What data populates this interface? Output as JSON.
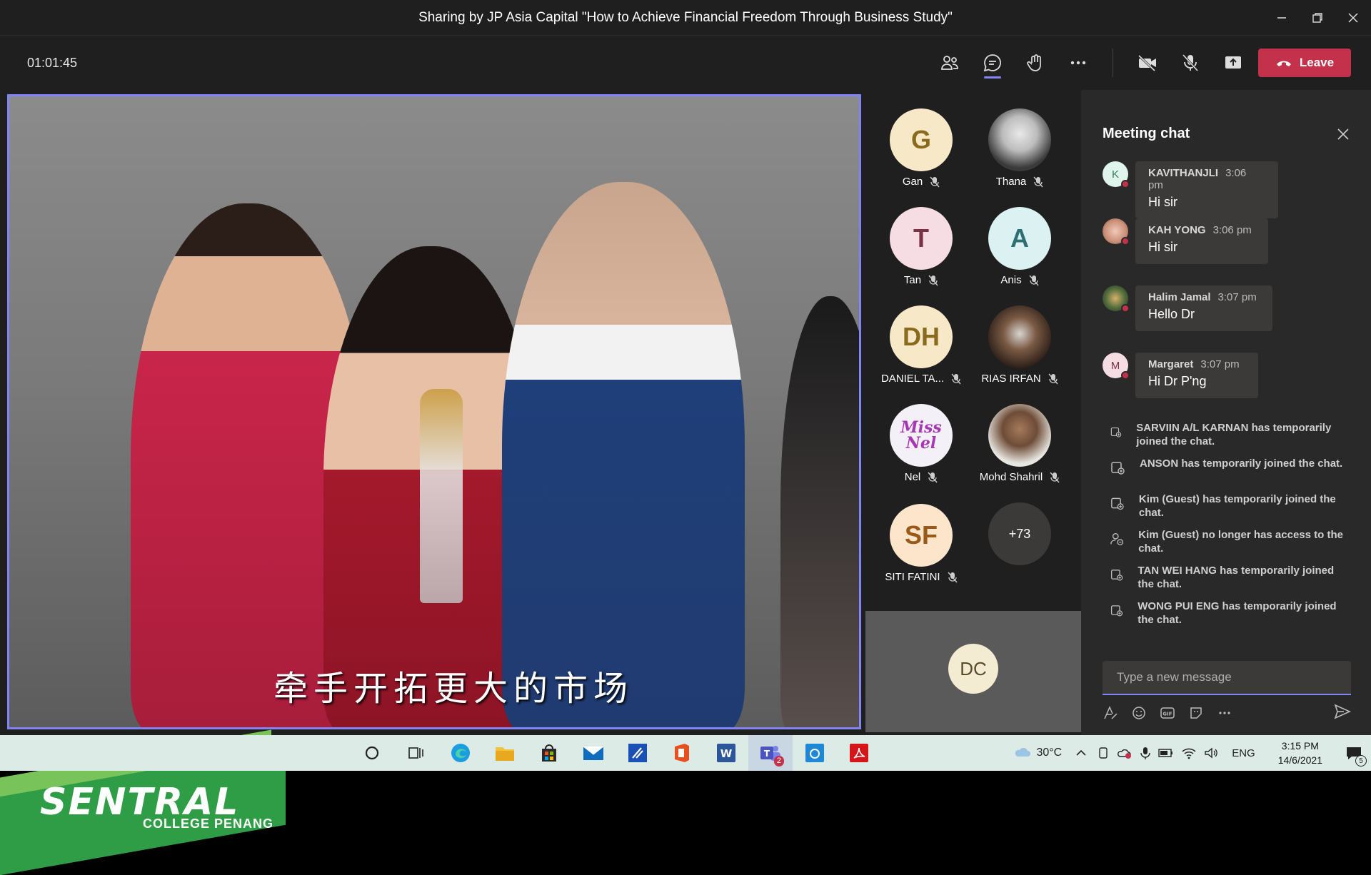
{
  "window": {
    "title": "Sharing by JP Asia Capital \"How to Achieve Financial Freedom Through Business Study\""
  },
  "toolbar": {
    "timer": "01:01:45",
    "leave_label": "Leave"
  },
  "video": {
    "subtitle": "牵手开拓更大的市场",
    "logo_brand": "SENTRAL",
    "logo_sub": "COLLEGE PENANG"
  },
  "participants": [
    {
      "initials": "G",
      "name": "Gan",
      "bg": "#f7e9c8",
      "fg": "#8a6a1c"
    },
    {
      "initials": "",
      "name": "Thana",
      "bg": "#cfcfcf",
      "fg": "#333"
    },
    {
      "initials": "T",
      "name": "Tan",
      "bg": "#f6dde3",
      "fg": "#7a3245"
    },
    {
      "initials": "A",
      "name": "Anis",
      "bg": "#dcf1f2",
      "fg": "#2d6f73"
    },
    {
      "initials": "DH",
      "name": "DANIEL TA...",
      "bg": "#f7e9c8",
      "fg": "#8a6a1c"
    },
    {
      "initials": "",
      "name": "RIAS IRFAN",
      "bg": "#4a3a30",
      "fg": "#fff"
    },
    {
      "initials": "Miss Nel",
      "name": "Nel",
      "bg": "#f4f0f7",
      "fg": "#a638b5"
    },
    {
      "initials": "",
      "name": "Mohd Shahril",
      "bg": "#7a6f64",
      "fg": "#fff"
    },
    {
      "initials": "SF",
      "name": "SITI FATINI",
      "bg": "#fde5cc",
      "fg": "#9a5a1a"
    },
    {
      "initials": "+73",
      "name": "",
      "bg": "#3b3a39",
      "fg": "#fff"
    }
  ],
  "overflow_participant": {
    "initials": "DC"
  },
  "chat": {
    "title": "Meeting chat",
    "messages": [
      {
        "initial": "K",
        "author": "KAVITHANJLI",
        "time": "3:06 pm",
        "text": "Hi sir"
      },
      {
        "initial": "",
        "author": "KAH YONG",
        "time": "3:06 pm",
        "text": "Hi sir"
      },
      {
        "initial": "",
        "author": "Halim Jamal",
        "time": "3:07 pm",
        "text": "Hello Dr"
      },
      {
        "initial": "M",
        "author": "Margaret",
        "time": "3:07 pm",
        "text": "Hi Dr P'ng"
      }
    ],
    "system": [
      "SARVIIN A/L KARNAN has temporarily joined the chat.",
      "ANSON has temporarily joined the chat.",
      "Kim (Guest) has temporarily joined the chat.",
      "Kim (Guest) no longer has access to the chat.",
      "TAN WEI HANG has temporarily joined the chat.",
      "WONG PUI ENG has temporarily joined the chat."
    ],
    "compose_placeholder": "Type a new message"
  },
  "taskbar": {
    "temperature": "30°C",
    "language": "ENG",
    "time": "3:15 PM",
    "date": "14/6/2021",
    "teams_badge": "2",
    "notification_count": "5"
  },
  "colors": {
    "accent": "#7f85f5",
    "leave": "#c4314b",
    "chat_bg": "#292929"
  }
}
